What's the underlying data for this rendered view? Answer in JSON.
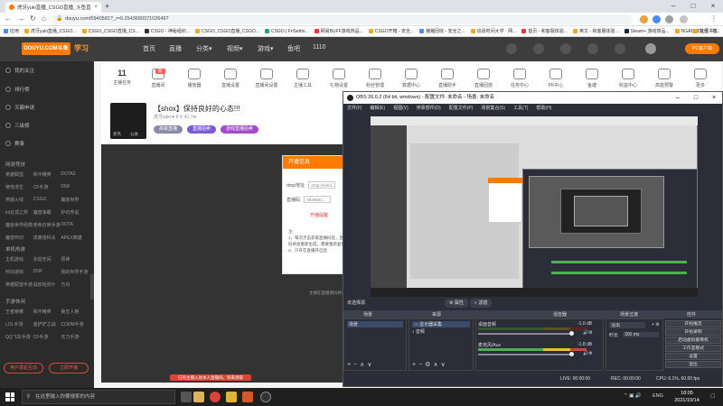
{
  "browser": {
    "tab_title": "虎牙yuki直播_CSGO直播_斗鱼直...",
    "url": "douyu.com/5940581?_r=0.2543690371026497",
    "new_tab": "+",
    "minimize": "–",
    "maximize": "□",
    "close": "×"
  },
  "bookmarks": [
    "应用",
    "虎牙yuki直播_CSGO...",
    "CSGO_CSGO直播_CS...",
    "CSGO - 神秘组织...",
    "CSGO_CSGO直播_CSGO...",
    "CSGO | FriSettin...",
    "网易BUFF游戏饰品...",
    "CSGO开箱 - 安全...",
    "猪猪回收 - 安全之...",
    "追逐时间大学 · 网...",
    "首页 - 和客服体验...",
    "英文 - 和客服体验...",
    "Steam+ 游戏饰品...",
    "NGA玩家社区 - N..."
  ],
  "bookmarks_right": "其他书签",
  "douyu": {
    "logo": "DOUYU.COM斗鱼",
    "logo2": "学习",
    "nav": [
      "首页",
      "直播",
      "分类▾",
      "视频▾",
      "游戏▾",
      "鱼吧",
      "1110"
    ],
    "pc_button": "PC客户端",
    "sidebar_top": [
      "我的关注",
      "排行榜",
      "灭霸申请",
      "三级榜",
      "赛事"
    ],
    "sidebar_section1": "网游竞技",
    "sidebar_grid1": [
      "英雄联盟",
      "和平精英",
      "DOTA2",
      "绝地求生",
      "CF手游",
      "DNF",
      "穿越火线",
      "CSGO",
      "魔兽世界",
      "lol云顶之弈",
      "魔兽争霸",
      "炉石传说",
      "魔兽世界经典",
      "使命召唤手游",
      "DOTA",
      "魔兽怀旧",
      "逃离塔科夫",
      "APEX英雄"
    ],
    "sidebar_section2": "单机热游",
    "sidebar_grid2": [
      "主机游戏",
      "永劫无间",
      "原神",
      "怀旧游戏",
      "DNF",
      "我的世界手游",
      "英雄联盟手游",
      "战双帕弥什",
      "方舟"
    ],
    "sidebar_section3": "手游休闲",
    "sidebar_grid3": [
      "王者荣耀",
      "和平精英",
      "第五人格",
      "LOL手游",
      "金铲铲之战",
      "CODM手游",
      "QQ飞车手游",
      "CF手游",
      "天刀手游"
    ],
    "sidebar_btn1": "用户发起互动",
    "sidebar_btn2": "立即开播",
    "categories": [
      {
        "label": "主播任务",
        "num": "11"
      },
      {
        "label": "直播间",
        "badge": "新"
      },
      {
        "label": "播放器"
      },
      {
        "label": "直播设置"
      },
      {
        "label": "直播间设置"
      },
      {
        "label": "主播工具"
      },
      {
        "label": "礼物设置"
      },
      {
        "label": "粉丝管理"
      },
      {
        "label": "数据中心"
      },
      {
        "label": "直播助手"
      },
      {
        "label": "直播回放"
      },
      {
        "label": "任务中心"
      },
      {
        "label": "PK中心"
      },
      {
        "label": "鱼塘"
      },
      {
        "label": "收益中心"
      },
      {
        "label": "高能预警"
      },
      {
        "label": "更多"
      }
    ],
    "room": {
      "avatar_labels": [
        "老鸟",
        "公会"
      ],
      "title": "【shox】保持良好的心态!!!",
      "meta": "虎牙yuki   ♥ 6   ⚲ 41.7w",
      "tags": [
        "高级直播",
        "直播拍卖 ",
        "游戏直播拍卖"
      ],
      "caption": "已有主播入驻本人直播间，快来领取"
    },
    "dialog": {
      "title": "开播信息",
      "rtmp_label": "rtmp地址",
      "rtmp_value": "rtmp://send...",
      "key_label": "直播码",
      "key_value": "5940581...",
      "warning": "开播提醒",
      "note_title": "注:",
      "note1": "1、每次点击获取直播码后，直播码将会重新生成，需要重新复制",
      "note2": "2、只有在直播开启后",
      "below": "主播在直播期间将会收到..."
    }
  },
  "obs": {
    "title": "OBS 26.0.2 (64 bit, windows) - 配置文件: 未命名 - 场景: 未命名",
    "menu": [
      "文件(F)",
      "编辑(E)",
      "视图(V)",
      "停靠部件(D)",
      "配置文件(P)",
      "场景集合(S)",
      "工具(T)",
      "帮助(H)"
    ],
    "no_source_label": "未选择源",
    "props": "属性",
    "filters": "滤镜",
    "docks": [
      "场景",
      "来源",
      "混音器",
      "场景过渡",
      "控件"
    ],
    "scenes": [
      "场景"
    ],
    "sources": [
      "显示器采集",
      "音频"
    ],
    "mixer": [
      {
        "name": "桌面音频",
        "db": "-1.0 dB"
      },
      {
        "name": "麦克风/Aux",
        "db": "-1.8 dB"
      }
    ],
    "transition": {
      "type": "淡出",
      "duration_label": "时长",
      "duration": "300 ms"
    },
    "controls": [
      "开始推流",
      "开始录制",
      "启动虚拟摄像机",
      "工作室模式",
      "设置",
      "退出"
    ],
    "status": {
      "live": "LIVE: 00:00:00",
      "rec": "REC: 00:00:00",
      "cpu": "CPU: 6.1%, 60.00 fps"
    }
  },
  "taskbar": {
    "search_placeholder": "在这里输入你要搜索的内容",
    "lang": "ENG",
    "time": "18:05",
    "date": "2021/10/14"
  },
  "colors": {
    "douyu_orange": "#ff7a00",
    "obs_bg": "#2b2e38",
    "chrome_tabbar": "#dee1e6"
  }
}
